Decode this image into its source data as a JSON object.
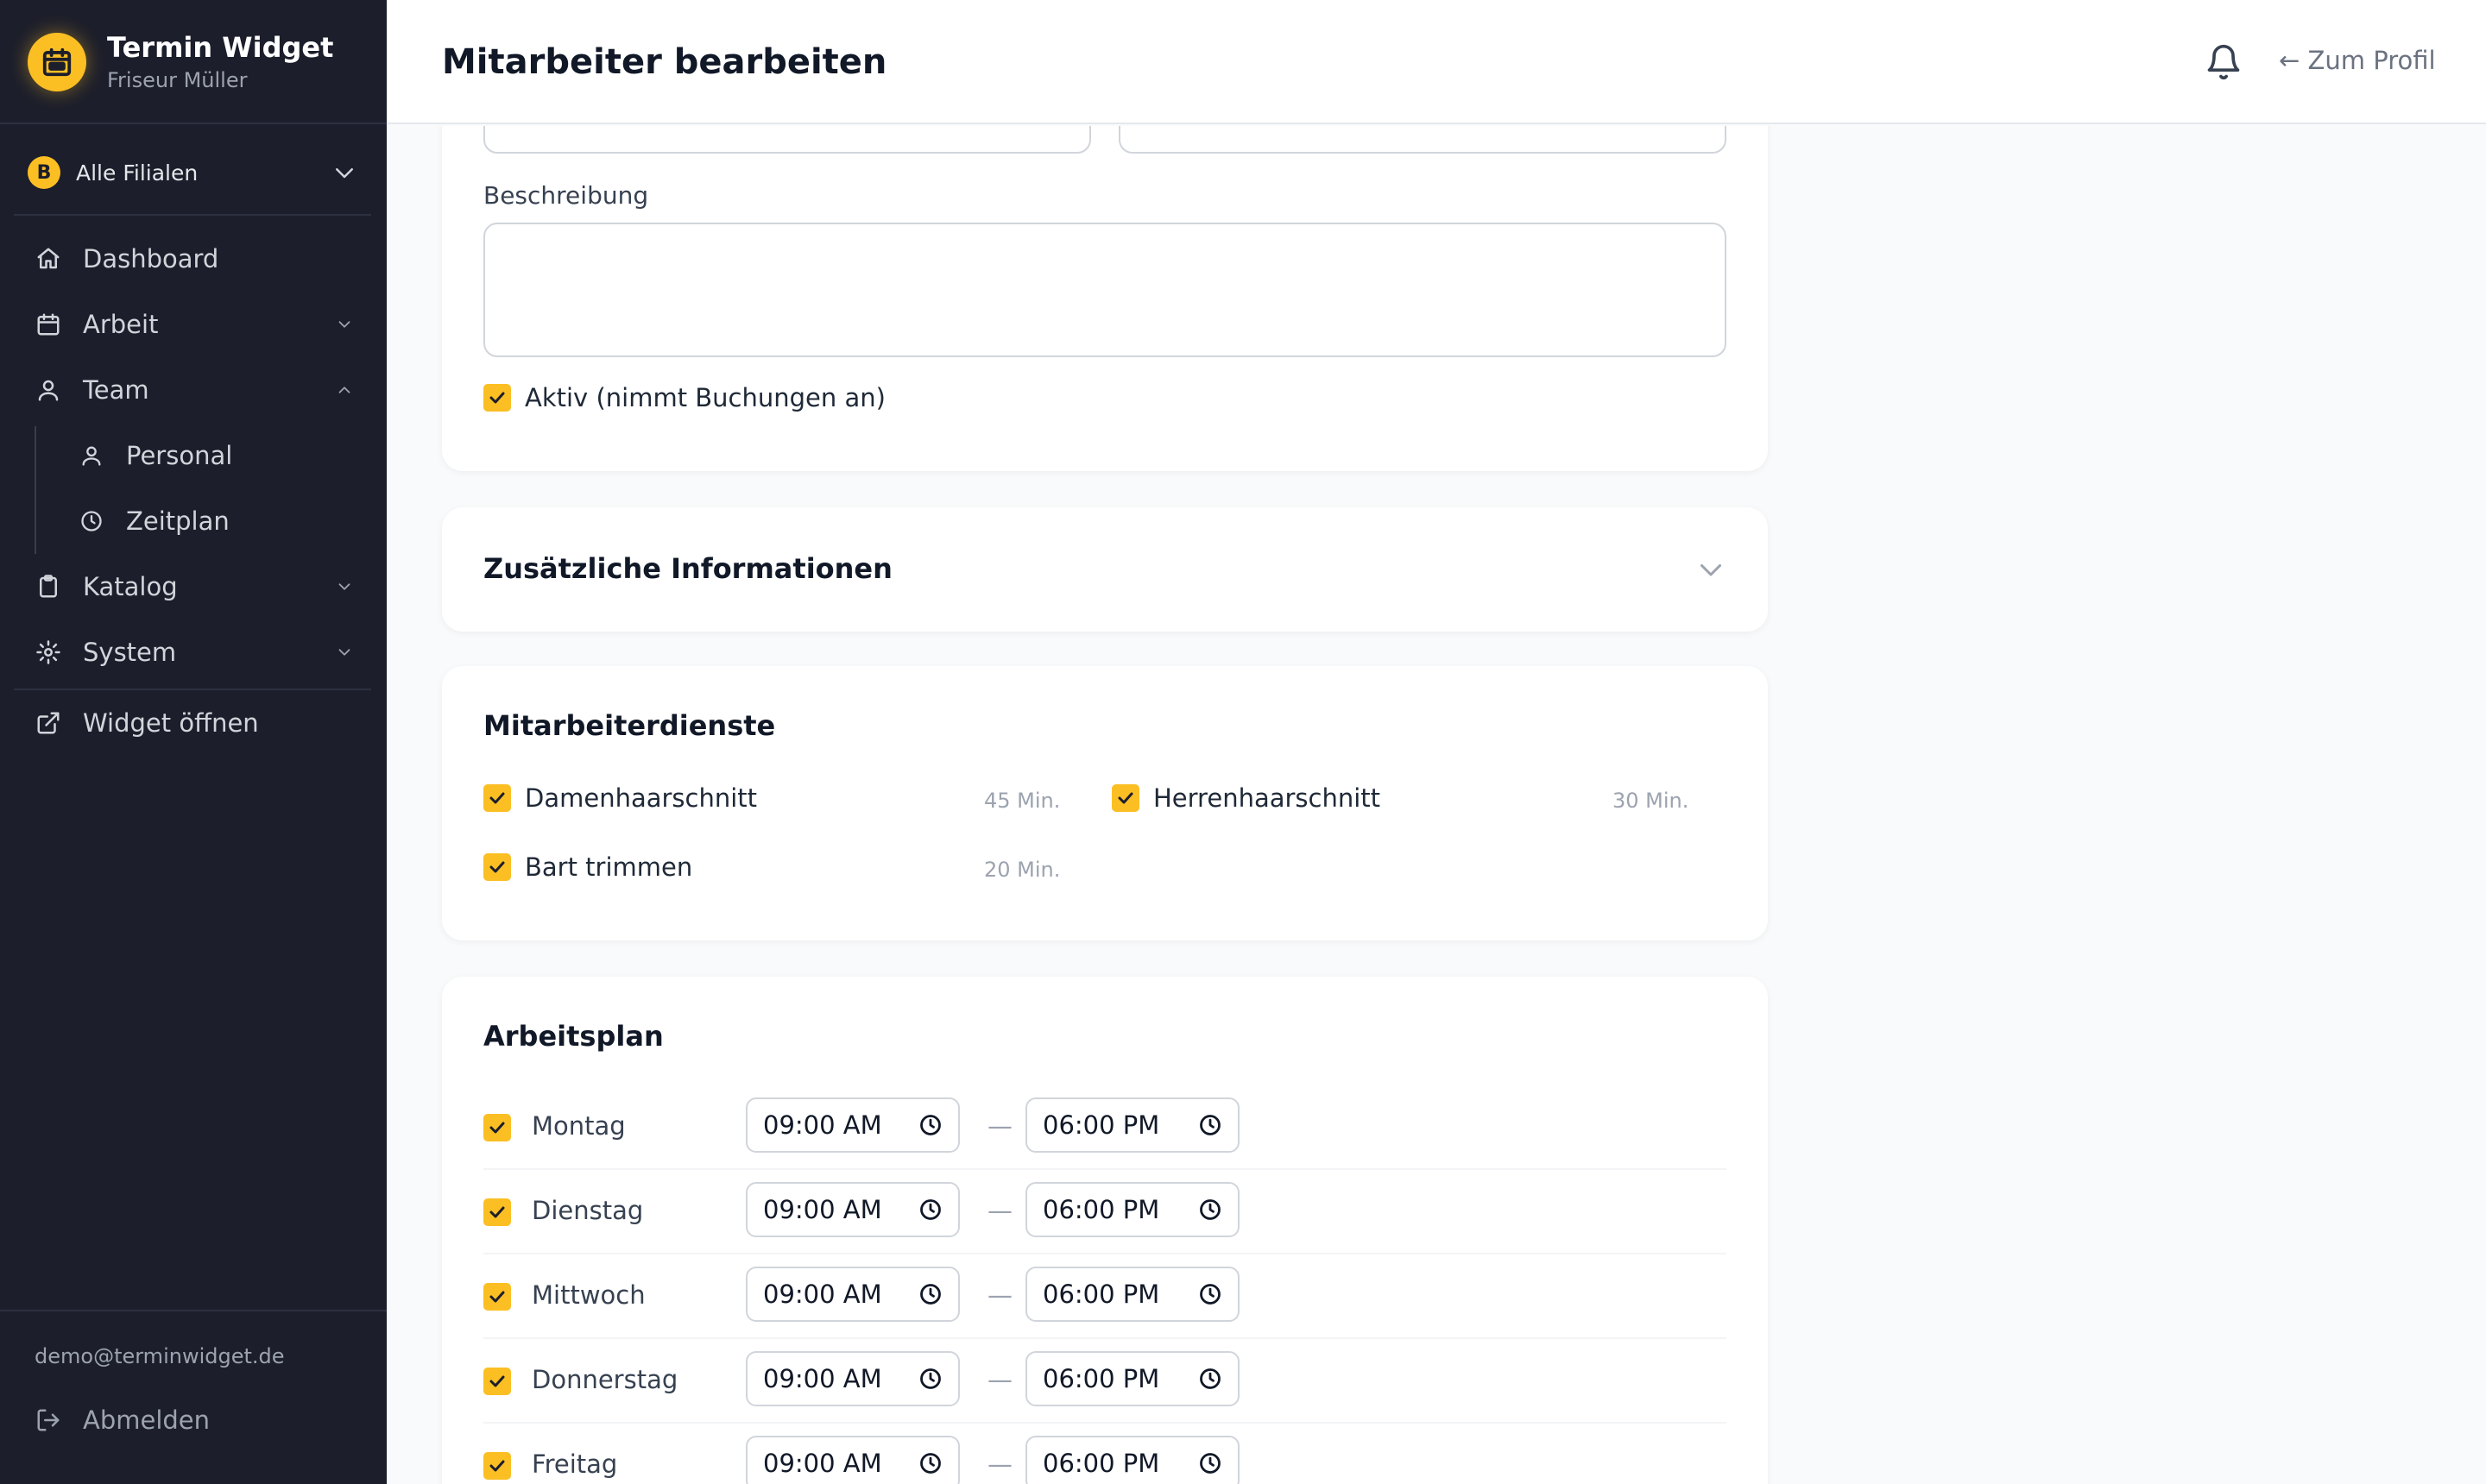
{
  "sidebar": {
    "brand_title": "Termin Widget",
    "brand_subtitle": "Friseur Müller",
    "branch_badge": "B",
    "branch_label": "Alle Filialen",
    "nav": {
      "dashboard": "Dashboard",
      "arbeit": "Arbeit",
      "team": "Team",
      "personal": "Personal",
      "zeitplan": "Zeitplan",
      "katalog": "Katalog",
      "system": "System",
      "widget": "Widget öffnen"
    },
    "user_email": "demo@terminwidget.de",
    "logout": "Abmelden"
  },
  "topbar": {
    "title": "Mitarbeiter bearbeiten",
    "back_link": "← Zum Profil"
  },
  "form": {
    "description_label": "Beschreibung",
    "active_label": "Aktiv (nimmt Buchungen an)"
  },
  "additional": {
    "title": "Zusätzliche Informationen"
  },
  "services": {
    "title": "Mitarbeiterdienste",
    "items": [
      {
        "name": "Damenhaarschnitt",
        "duration": "45 Min."
      },
      {
        "name": "Herrenhaarschnitt",
        "duration": "30 Min."
      },
      {
        "name": "Bart trimmen",
        "duration": "20 Min."
      }
    ]
  },
  "schedule": {
    "title": "Arbeitsplan",
    "separator": "—",
    "days": [
      {
        "name": "Montag",
        "start": "09:00 AM",
        "end": "06:00 PM"
      },
      {
        "name": "Dienstag",
        "start": "09:00 AM",
        "end": "06:00 PM"
      },
      {
        "name": "Mittwoch",
        "start": "09:00 AM",
        "end": "06:00 PM"
      },
      {
        "name": "Donnerstag",
        "start": "09:00 AM",
        "end": "06:00 PM"
      },
      {
        "name": "Freitag",
        "start": "09:00 AM",
        "end": "06:00 PM"
      }
    ]
  },
  "colors": {
    "sidebar_bg": "#1c1e2b",
    "accent": "#fbbf24",
    "page_bg": "#f9fafb"
  }
}
